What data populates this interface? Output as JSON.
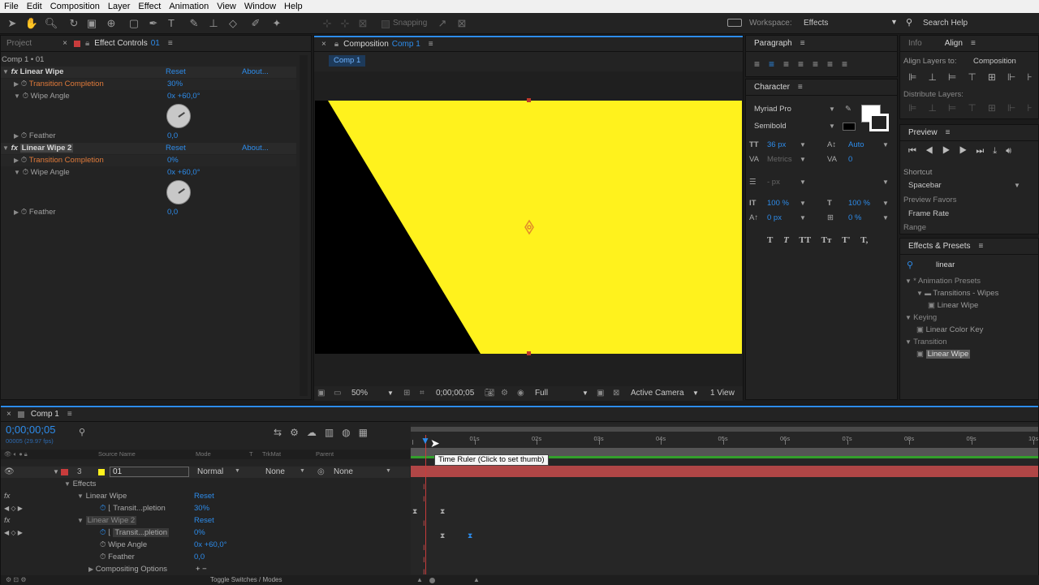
{
  "menu": [
    "File",
    "Edit",
    "Composition",
    "Layer",
    "Effect",
    "Animation",
    "View",
    "Window",
    "Help"
  ],
  "toolbar": {
    "snapping": "Snapping",
    "workspace_label": "Workspace:",
    "workspace_value": "Effects",
    "search_help": "Search Help"
  },
  "left_panel": {
    "tab_project": "Project",
    "tab_effect_controls": "Effect Controls",
    "ec_layer": "01",
    "breadcrumb": "Comp 1 • 01",
    "effect1": {
      "name": "Linear Wipe",
      "reset": "Reset",
      "about": "About...",
      "p1": "Transition Completion",
      "v1": "30%",
      "p2": "Wipe Angle",
      "v2": "0x +60,0°",
      "p3": "Feather",
      "v3": "0,0"
    },
    "effect2": {
      "name": "Linear Wipe 2",
      "reset": "Reset",
      "about": "About...",
      "p1": "Transition Completion",
      "v1": "0%",
      "p2": "Wipe Angle",
      "v2": "0x +60,0°",
      "p3": "Feather",
      "v3": "0,0"
    }
  },
  "comp": {
    "tab_label": "Composition",
    "tab_name": "Comp 1",
    "subtab": "Comp 1",
    "zoom": "50%",
    "timecode": "0;00;00;05",
    "resolution": "Full",
    "camera": "Active Camera",
    "views": "1 View",
    "colors": {
      "yellow": "#fff21d",
      "black": "#000000"
    }
  },
  "paragraph": {
    "title": "Paragraph"
  },
  "character": {
    "title": "Character",
    "font": "Myriad Pro",
    "style": "Semibold",
    "size": "36 px",
    "leading": "Auto",
    "kerning": "Metrics",
    "tracking": "0",
    "stroke": "- px",
    "vscale": "100 %",
    "hscale": "100 %",
    "baseline": "0 px",
    "tsume": "0 %",
    "styles": [
      "T",
      "T",
      "TT",
      "Tт",
      "T'",
      "T,"
    ]
  },
  "right": {
    "tab_info": "Info",
    "tab_align": "Align",
    "align_to_label": "Align Layers to:",
    "align_to_value": "Composition",
    "distribute": "Distribute Layers:",
    "preview": {
      "title": "Preview",
      "shortcut_label": "Shortcut",
      "shortcut_value": "Spacebar",
      "favors": "Preview Favors",
      "framerate": "Frame Rate",
      "range": "Range"
    },
    "effects_presets": {
      "title": "Effects & Presets",
      "search": "linear",
      "tree": [
        {
          "label": "* Animation Presets",
          "indent": 0,
          "kind": "cat"
        },
        {
          "label": "Transitions - Wipes",
          "indent": 1,
          "kind": "folder"
        },
        {
          "label": "Linear Wipe",
          "indent": 2,
          "kind": "fx"
        },
        {
          "label": "Keying",
          "indent": 0,
          "kind": "cat"
        },
        {
          "label": "Linear Color Key",
          "indent": 1,
          "kind": "fx"
        },
        {
          "label": "Transition",
          "indent": 0,
          "kind": "cat"
        },
        {
          "label": "Linear Wipe",
          "indent": 1,
          "kind": "fx-selected"
        }
      ]
    }
  },
  "timeline": {
    "tab": "Comp 1",
    "timecode": "0;00;00;05",
    "fps": "00005 (29.97 fps)",
    "cols": {
      "source": "Source Name",
      "mode": "Mode",
      "t": "T",
      "trkmat": "TrkMat",
      "parent": "Parent"
    },
    "layer": {
      "num": "3",
      "name": "01",
      "mode": "Normal",
      "trkmat": "None",
      "parent": "None"
    },
    "effects": "Effects",
    "fx1": "Linear Wipe",
    "fx1_reset": "Reset",
    "fx1_prop": "Transit...pletion",
    "fx1_val": "30%",
    "fx2": "Linear Wipe 2",
    "fx2_reset": "Reset",
    "fx2_prop": "Transit...pletion",
    "fx2_val": "0%",
    "fx2_angle": "Wipe Angle",
    "fx2_angle_val": "0x +60,0°",
    "fx2_feather": "Feather",
    "fx2_feather_val": "0,0",
    "compositing": "Compositing Options",
    "compositing_val": "+ −",
    "ruler": [
      "01s",
      "02s",
      "03s",
      "04s",
      "05s",
      "06s",
      "07s",
      "08s",
      "09s",
      "10s"
    ],
    "tooltip": "Time Ruler (Click to set thumb)",
    "toggle": "Toggle Switches / Modes"
  }
}
